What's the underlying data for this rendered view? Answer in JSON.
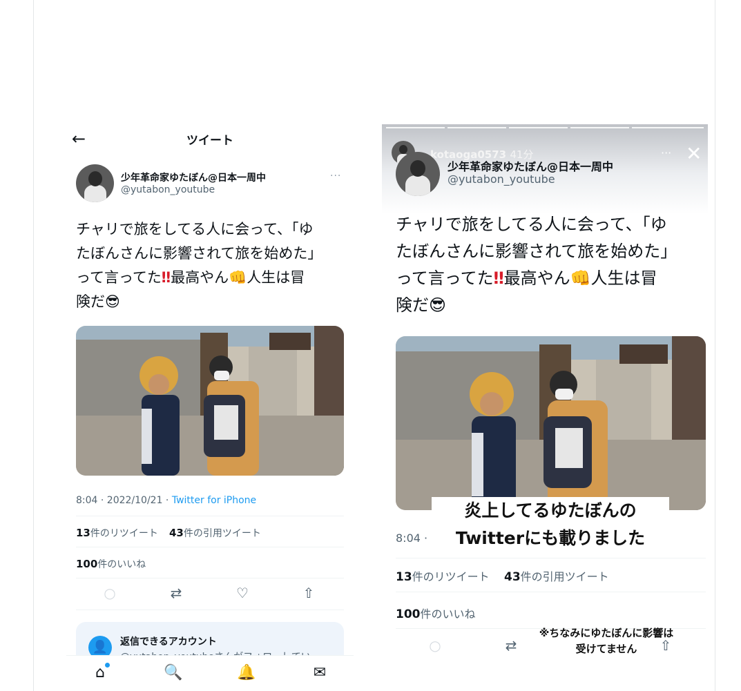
{
  "left": {
    "header_title": "ツイート",
    "author": {
      "name": "少年革命家ゆたぼん@日本一周中",
      "handle": "@yutabon_youtube"
    },
    "tweet_lines": [
      "チャリで旅をしてる人に会って、「ゆ",
      "たぼんさんに影響されて旅を始めた」",
      "って言ってた",
      "最高やん",
      "人生は冒",
      "険だ"
    ],
    "emoji": {
      "bang": "‼",
      "fist": "👊",
      "cool": "😎"
    },
    "meta_time": "8:04 · 2022/10/21 · ",
    "meta_source": "Twitter for iPhone",
    "retweets_count": "13",
    "retweets_label": "件のリツイート",
    "quotes_count": "43",
    "quotes_label": "件の引用ツイート",
    "likes_count": "100",
    "likes_label": "件のいいね",
    "reply_card_title": "返信できるアカウント",
    "reply_card_sub": "@yutabon_youtubeさんがフォローしてい"
  },
  "right": {
    "story_user": "kotaoga0573",
    "story_time": "41分",
    "author": {
      "name": "少年革命家ゆたぼん@日本一周中",
      "handle": "@yutabon_youtube"
    },
    "caption_line1": "炎上してるゆたぼんの",
    "caption_line2": "Twitterにも載りました",
    "meta_time": "8:04 ·",
    "retweets_count": "13",
    "retweets_label": "件のリツイート",
    "quotes_count": "43",
    "quotes_label": "件の引用ツイート",
    "likes_count": "100",
    "likes_label": "件のいいね",
    "note": "※ちなみにゆたぼんに影響は\n受けてません"
  },
  "colors": {
    "link": "#1d9bf0",
    "muted": "#536471",
    "text": "#0f1419",
    "bang": "#d81d2a"
  }
}
